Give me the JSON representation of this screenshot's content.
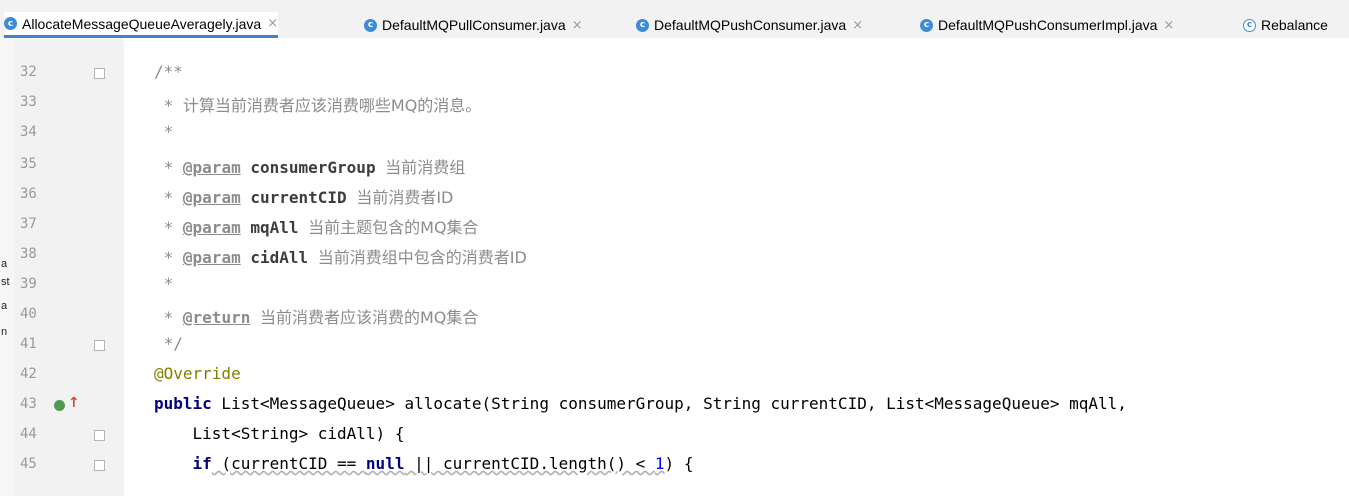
{
  "tabs": [
    {
      "label": "AllocateMessageQueueAveragely.java",
      "active": true
    },
    {
      "label": "DefaultMQPullConsumer.java",
      "active": false
    },
    {
      "label": "DefaultMQPushConsumer.java",
      "active": false
    },
    {
      "label": "DefaultMQPushConsumerImpl.java",
      "active": false
    },
    {
      "label": "Rebalance",
      "active": false
    }
  ],
  "tab_icon_letter": "c",
  "tab_close_glyph": "×",
  "left_strip_glyphs": [
    "a",
    "st",
    "a",
    "n"
  ],
  "line_numbers": [
    "32",
    "33",
    "34",
    "35",
    "36",
    "37",
    "38",
    "39",
    "40",
    "41",
    "42",
    "43",
    "44",
    "45"
  ],
  "code": {
    "l32": "/**",
    "l33_prefix": " * ",
    "l33_text": "计算当前消费者应该消费哪些MQ的消息。",
    "l34": " *",
    "l35_tag": "@param",
    "l35_name": "consumerGroup",
    "l35_desc": "当前消费组",
    "l36_tag": "@param",
    "l36_name": "currentCID",
    "l36_desc": "当前消费者ID",
    "l37_tag": "@param",
    "l37_name": "mqAll",
    "l37_desc": "当前主题包含的MQ集合",
    "l38_tag": "@param",
    "l38_name": "cidAll",
    "l38_desc": "当前消费组中包含的消费者ID",
    "l39": " *",
    "l40_tag": "@return",
    "l40_desc": "当前消费者应该消费的MQ集合",
    "l41": " */",
    "l42": "@Override",
    "l43_kw": "public",
    "l43_rest": " List<MessageQueue> allocate(String consumerGroup, String currentCID, List<MessageQueue> mqAll,",
    "l44": "    List<String> cidAll) {",
    "l45_if": "if",
    "l45_a": " (currentCID == ",
    "l45_null": "null",
    "l45_b": " || currentCID.length() < ",
    "l45_num": "1",
    "l45_c": ") {"
  },
  "colors": {
    "keyword": "#000080",
    "annotation": "#808000",
    "comment": "#8c8c8c",
    "number": "#0000ff",
    "tab_accent": "#4083c9"
  },
  "icons": [
    "class-file-icon",
    "implementing-method-icon",
    "override-up-arrow-icon",
    "fold-marker-icon"
  ]
}
